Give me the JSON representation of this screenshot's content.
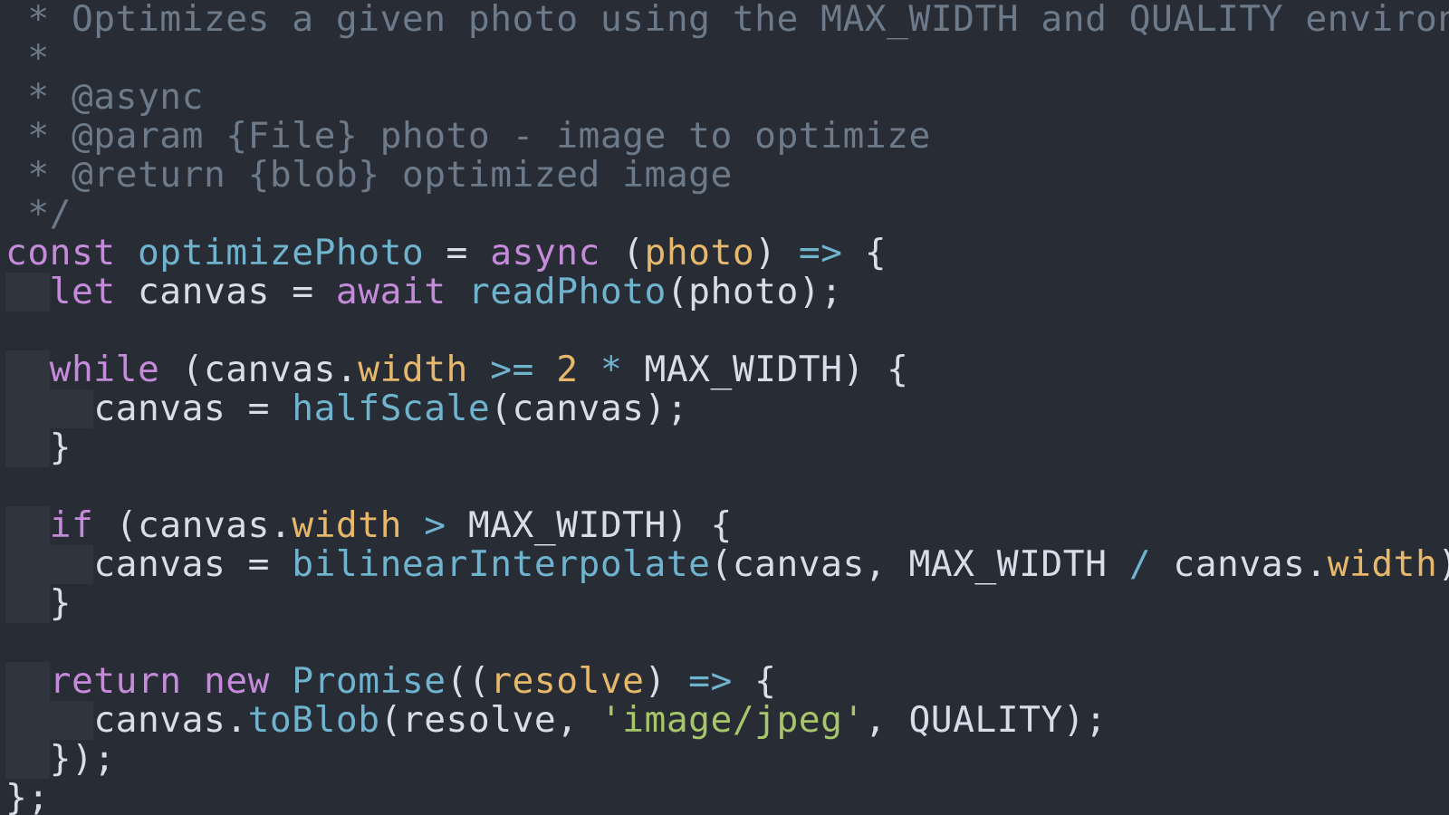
{
  "code": {
    "comment_l1": " * Optimizes a given photo using the MAX_WIDTH and QUALITY environment variables",
    "comment_l2": " *",
    "comment_l3": " * @async",
    "comment_l4": " * @param {File} photo - image to optimize",
    "comment_l5": " * @return {blob} optimized image",
    "comment_l6": " */",
    "kw_const": "const",
    "id_optimizePhoto": "optimizePhoto",
    "op_assign": " = ",
    "kw_async": "async",
    "paren_open": " (",
    "param_photo": "photo",
    "paren_close_arrow": ") ",
    "op_arrow": "=>",
    "brace_open": " {",
    "kw_let": "let",
    "id_canvas": "canvas",
    "kw_await": "await",
    "fn_readPhoto": "readPhoto",
    "lp": "(",
    "rp_semi": ");",
    "kw_while": "while",
    "while_open": " (",
    "id_canvas2": "canvas",
    "dot": ".",
    "prop_width": "width",
    "op_gte": " >= ",
    "num_2": "2",
    "op_mul": " * ",
    "id_MAX_WIDTH": "MAX_WIDTH",
    "rp_brace": ") {",
    "fn_halfScale": "halfScale",
    "rp_semi2": ");",
    "brace_close": "}",
    "kw_if": "if",
    "op_gt": " > ",
    "fn_bilinearInterpolate": "bilinearInterpolate",
    "comma": ", ",
    "op_div": " / ",
    "kw_return": "return",
    "kw_new": "new",
    "cls_Promise": "Promise",
    "dbl_lp": "((",
    "param_resolve": "resolve",
    "rp": ") ",
    "fn_toBlob": "toBlob",
    "str_jpeg": "'image/jpeg'",
    "id_QUALITY": "QUALITY",
    "rp_semi3": ");",
    "close_promise": "});",
    "close_fn": "};",
    "sp": " ",
    "ws2": "  ",
    "ws4": "    "
  }
}
